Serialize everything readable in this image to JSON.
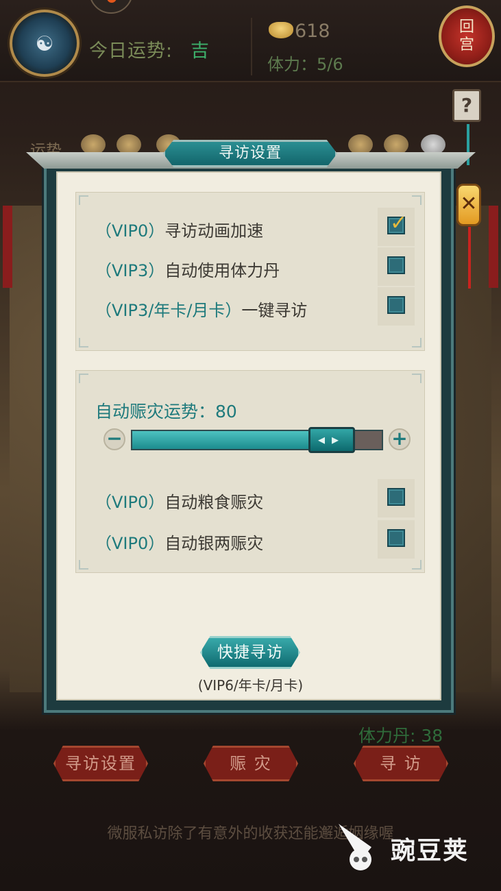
{
  "hud": {
    "luck_label": "今日运势:",
    "luck_value": "吉",
    "silver": "618",
    "stamina_label": "体力：",
    "stamina_value": "5/6",
    "return_line1": "回",
    "return_line2": "宫",
    "help": "?",
    "close": "✕"
  },
  "background": {
    "luck_row_label": "运势"
  },
  "modal": {
    "title": "寻访设置",
    "options": [
      {
        "vip": "（VIP0）",
        "label": "寻访动画加速",
        "checked": true
      },
      {
        "vip": "（VIP3）",
        "label": "自动使用体力丹",
        "checked": false
      },
      {
        "vip": "（VIP3/年卡/月卡）",
        "label": "一键寻访",
        "checked": false
      }
    ],
    "relief": {
      "label": "自动赈灾运势：80",
      "value": 80,
      "max": 100,
      "minus": "−",
      "plus": "+",
      "thumb": "◂▸"
    },
    "relief_options": [
      {
        "vip": "（VIP0）",
        "label": "自动粮食赈灾",
        "checked": false
      },
      {
        "vip": "（VIP0）",
        "label": "自动银两赈灾",
        "checked": false
      }
    ],
    "quick_button": "快捷寻访",
    "quick_note": "(VIP6/年卡/月卡)"
  },
  "bottom": {
    "pill_count": "体力丹: 38",
    "buttons": [
      "寻访设置",
      "赈 灾",
      "寻 访"
    ],
    "hint": "微服私访除了有意外的收获还能邂逅姻缘喔"
  },
  "watermark": {
    "text": "豌豆荚"
  }
}
